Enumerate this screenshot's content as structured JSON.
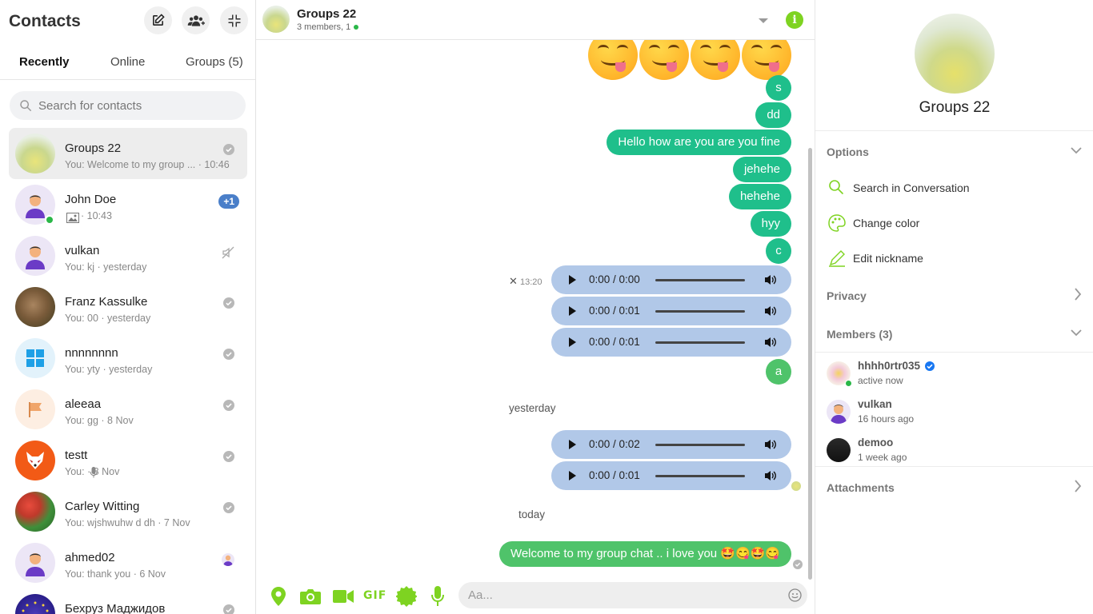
{
  "sidebar": {
    "title": "Contacts",
    "tabs": [
      {
        "label": "Recently"
      },
      {
        "label": "Online"
      },
      {
        "label": "Groups (5)"
      }
    ],
    "search_placeholder": "Search for contacts",
    "contacts": [
      {
        "name": "Groups 22",
        "sub": "You: Welcome to my group ... · 10:46"
      },
      {
        "name": "John Doe",
        "sub": " · 10:43",
        "badge": "+1"
      },
      {
        "name": "vulkan",
        "sub": "You: kj · yesterday"
      },
      {
        "name": "Franz Kassulke",
        "sub": "You: 00 · yesterday"
      },
      {
        "name": "nnnnnnnn",
        "sub": "You: yty · yesterday"
      },
      {
        "name": "aleeaa",
        "sub": "You: gg · 8 Nov"
      },
      {
        "name": "testt",
        "sub": "You:  · 8 Nov"
      },
      {
        "name": "Carley Witting",
        "sub": "You: wjshwuhw d dh · 7 Nov"
      },
      {
        "name": "ahmed02",
        "sub": "You: thank you · 6 Nov"
      },
      {
        "name": "Бехруз Маджидов",
        "sub": ""
      }
    ]
  },
  "chat": {
    "title": "Groups 22",
    "subtitle": "3 members, 1",
    "messages": {
      "s": "s",
      "dd": "dd",
      "hello": "Hello how are you are you fine",
      "jehehe": "jehehe",
      "hehehe": "hehehe",
      "hyy": "hyy",
      "c": "c",
      "a": "a",
      "welcome": "Welcome to my group chat .. i love you 🤩😋🤩😋"
    },
    "audio_times": [
      "0:00 / 0:00",
      "0:00 / 0:01",
      "0:00 / 0:01",
      "0:00 / 0:02",
      "0:00 / 0:01"
    ],
    "audio_time_label": "13:20",
    "separators": {
      "yesterday": "yesterday",
      "today": "today"
    },
    "input_placeholder": "Aa..."
  },
  "info": {
    "name": "Groups 22",
    "sections": {
      "options": "Options",
      "privacy": "Privacy",
      "members": "Members (3)",
      "attachments": "Attachments"
    },
    "options": [
      {
        "label": "Search in Conversation"
      },
      {
        "label": "Change color"
      },
      {
        "label": "Edit nickname"
      }
    ],
    "members": [
      {
        "name": "hhhh0rtr035",
        "sub": "active now"
      },
      {
        "name": "vulkan",
        "sub": "16 hours ago"
      },
      {
        "name": "demoo",
        "sub": "1 week ago"
      }
    ]
  },
  "colors": {
    "accent_green": "#7ed321",
    "bubble_teal": "#1fbf8b",
    "audio_blue": "#b1c8e8",
    "badge_blue": "#4a7fc9"
  }
}
